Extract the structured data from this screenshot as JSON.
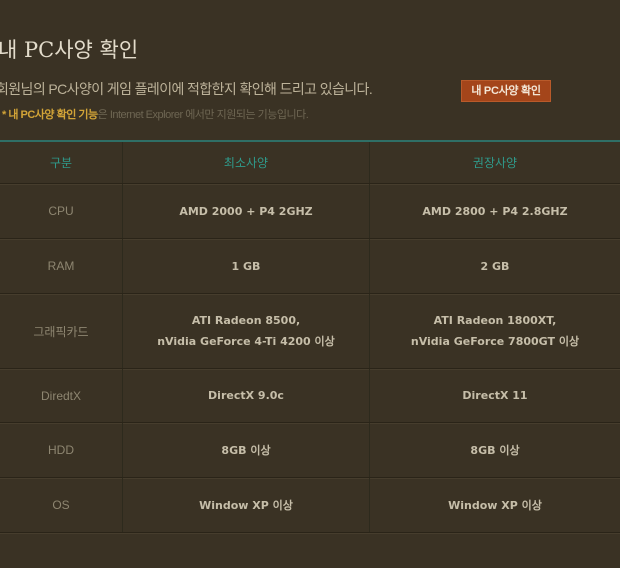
{
  "page": {
    "title": "내 PC사양 확인",
    "description": "회원님의 PC사양이 게임 플레이에 적합한지 확인해 드리고 있습니다.",
    "note_star": "*",
    "note_strong": "내 PC사양 확인 기능",
    "note_rest": "은 Internet Explorer 에서만 지원되는 기능입니다.",
    "check_button": "내 PC사양 확인"
  },
  "colors": {
    "background": "#3a3224",
    "accent_teal": "#2f9a8b",
    "button": "#a4451a",
    "highlight": "#d2a437"
  },
  "table": {
    "headers": {
      "category": "구분",
      "minimum": "최소사양",
      "recommended": "권장사양"
    },
    "rows": [
      {
        "label": "CPU",
        "min": [
          "AMD 2000 + P4 2GHZ"
        ],
        "rec": [
          "AMD 2800 + P4 2.8GHZ"
        ]
      },
      {
        "label": "RAM",
        "min": [
          "1 GB"
        ],
        "rec": [
          "2 GB"
        ]
      },
      {
        "label": "그래픽카드",
        "min": [
          "ATI Radeon 8500,",
          "nVidia GeForce 4-Ti 4200 이상"
        ],
        "rec": [
          "ATI Radeon 1800XT,",
          "nVidia GeForce 7800GT 이상"
        ]
      },
      {
        "label": "DiredtX",
        "min": [
          "DirectX 9.0c"
        ],
        "rec": [
          "DirectX 11"
        ]
      },
      {
        "label": "HDD",
        "min": [
          "8GB 이상"
        ],
        "rec": [
          "8GB 이상"
        ]
      },
      {
        "label": "OS",
        "min": [
          "Window XP 이상"
        ],
        "rec": [
          "Window XP 이상"
        ]
      }
    ]
  }
}
